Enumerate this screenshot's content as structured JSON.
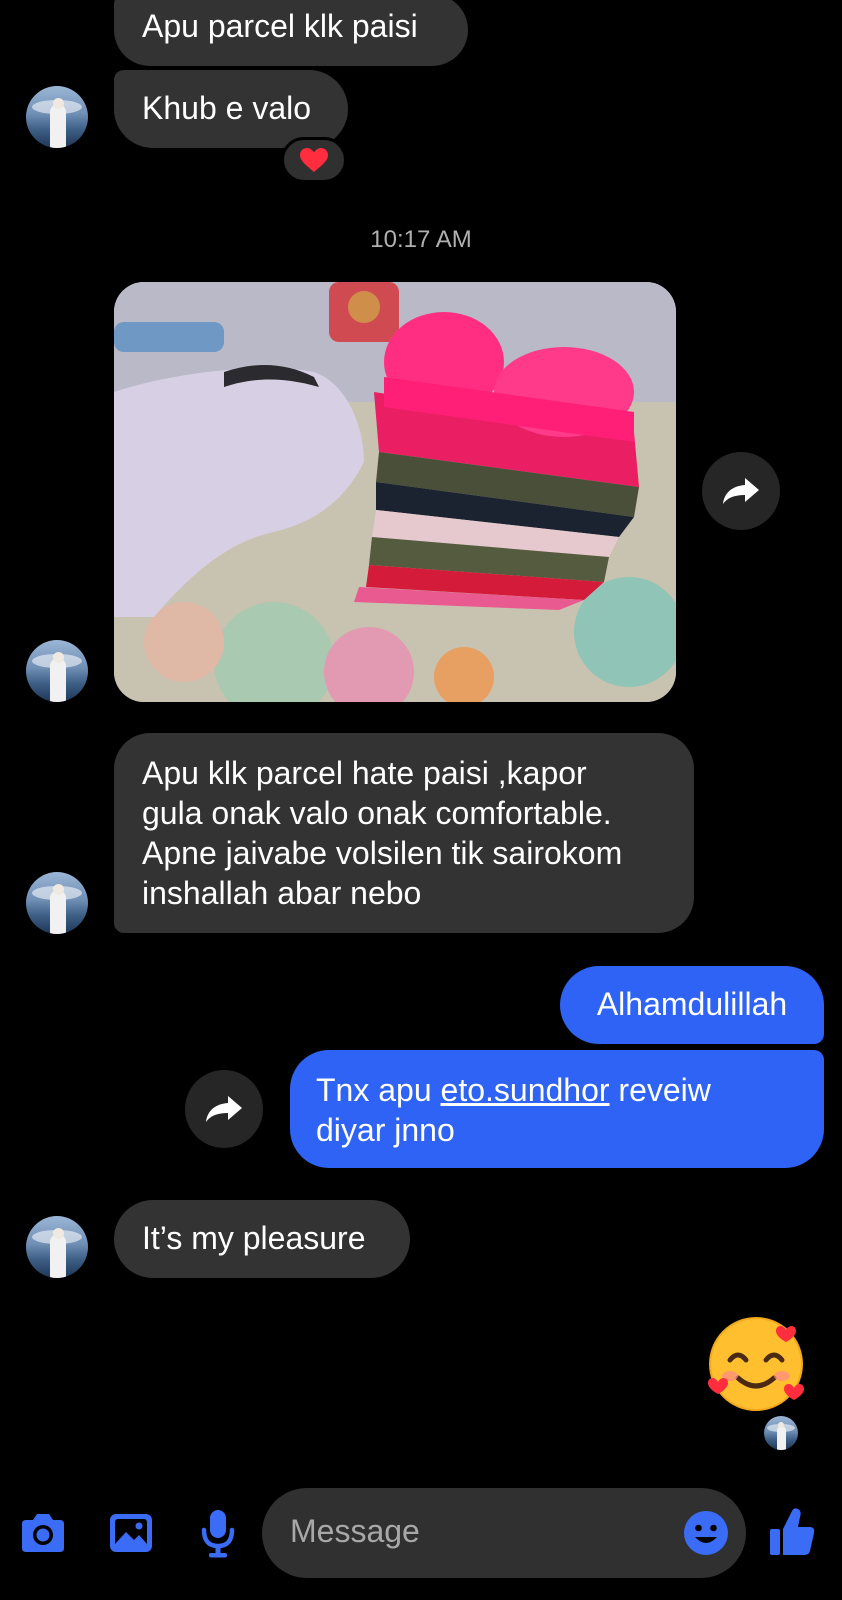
{
  "messages": {
    "m1": "Apu parcel klk paisi",
    "m2": "Khub e valo",
    "m2_reaction": "❤️",
    "timestamp": "10:17 AM",
    "m4_lines": [
      "Apu klk parcel hate paisi ,kapor",
      "gula onak valo onak comfortable.",
      "Apne jaivabe volsilen tik sairokom",
      "inshallah abar nebo"
    ],
    "out1": "Alhamdulillah",
    "out2_pre": "Tnx apu ",
    "out2_link": "eto.sundhor",
    "out2_post": " reveiw",
    "out2_line2": "diyar jnno",
    "m5": "It’s my pleasure",
    "sticker": "🥰"
  },
  "composer": {
    "placeholder": "Message"
  },
  "colors": {
    "outgoing_bubble": "#2f63f5",
    "incoming_bubble": "#333333",
    "accent_icon": "#3b6cf6",
    "background": "#000000"
  },
  "icons": [
    "camera-icon",
    "image-icon",
    "microphone-icon",
    "emoji-icon",
    "thumbs-up-icon",
    "forward-icon",
    "heart-icon"
  ]
}
